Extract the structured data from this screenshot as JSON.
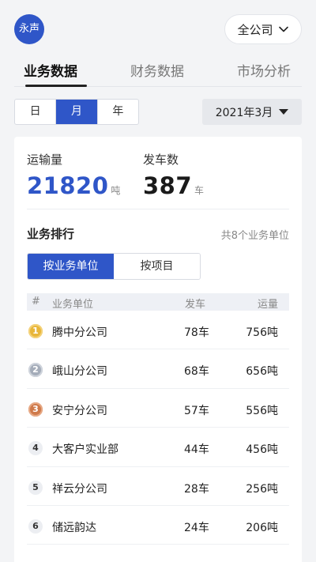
{
  "header": {
    "avatar_text": "永声",
    "company_select": {
      "value": "全公司",
      "icon": "chevron-down-icon"
    }
  },
  "tabs": [
    {
      "label": "业务数据",
      "active": true
    },
    {
      "label": "财务数据",
      "active": false
    },
    {
      "label": "市场分析",
      "active": false
    }
  ],
  "period": {
    "options": [
      "日",
      "月",
      "年"
    ],
    "selected": "月"
  },
  "date_select": {
    "value": "2021年3月",
    "icon": "caret-down-icon"
  },
  "stats": [
    {
      "label": "运输量",
      "value": "21820",
      "unit": "吨"
    },
    {
      "label": "发车数",
      "value": "387",
      "unit": "车"
    }
  ],
  "ranking": {
    "title": "业务排行",
    "count_text": "共8个业务单位",
    "toggle": [
      "按业务单位",
      "按项目"
    ],
    "columns": [
      "#",
      "业务单位",
      "发车",
      "运量"
    ],
    "rows": [
      {
        "rank": "1",
        "name": "腾中分公司",
        "cars": "78车",
        "volume": "756吨"
      },
      {
        "rank": "2",
        "name": "峨山分公司",
        "cars": "68车",
        "volume": "656吨"
      },
      {
        "rank": "3",
        "name": "安宁分公司",
        "cars": "57车",
        "volume": "556吨"
      },
      {
        "rank": "4",
        "name": "大客户实业部",
        "cars": "44车",
        "volume": "456吨"
      },
      {
        "rank": "5",
        "name": "祥云分公司",
        "cars": "28车",
        "volume": "256吨"
      },
      {
        "rank": "6",
        "name": "储远韵达",
        "cars": "24车",
        "volume": "206吨"
      }
    ]
  },
  "colors": {
    "accent": "#2f56c8",
    "gold": "#e8b63a",
    "silver": "#a5adba",
    "bronze": "#cf7a4b"
  }
}
